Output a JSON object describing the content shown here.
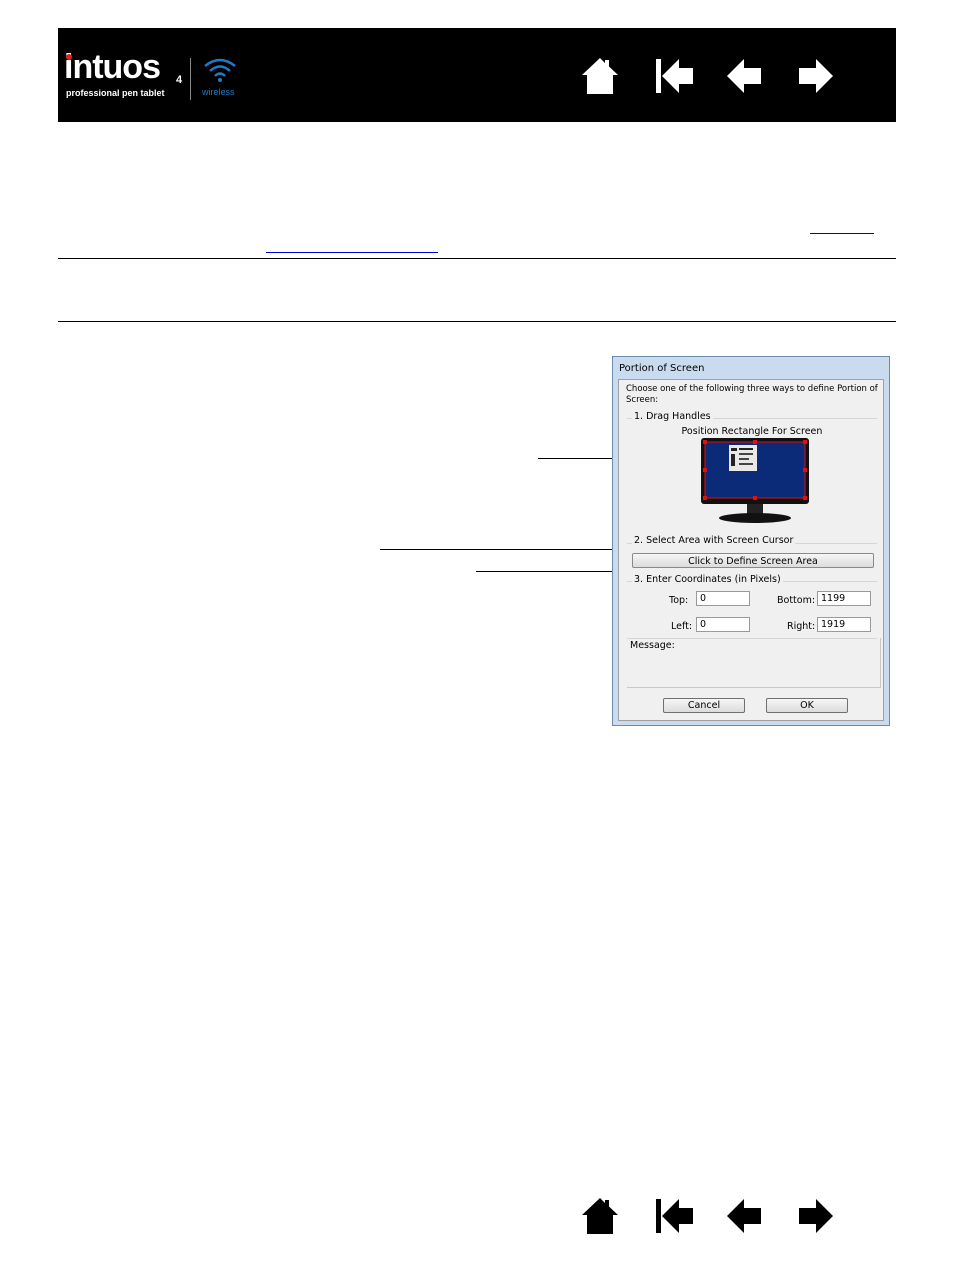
{
  "header": {
    "logo": {
      "brand": "intuos",
      "model_number": "4",
      "tagline": "professional pen tablet",
      "variant": "wireless"
    },
    "nav": [
      {
        "name": "home-icon",
        "label": "Home"
      },
      {
        "name": "first-page-icon",
        "label": "Contents"
      },
      {
        "name": "previous-page-icon",
        "label": "Previous page"
      },
      {
        "name": "next-page-icon",
        "label": "Next page"
      }
    ]
  },
  "dialog": {
    "title": "Portion of Screen",
    "instructions": "Choose one of the following three ways to define Portion of Screen:",
    "group1_title": "1. Drag Handles",
    "position_label": "Position Rectangle For Screen",
    "group2_title": "2. Select Area with Screen Cursor",
    "define_button": "Click to Define Screen Area",
    "group3_title": "3. Enter Coordinates (in Pixels)",
    "coords": {
      "top_label": "Top:",
      "top_value": "0",
      "bottom_label": "Bottom:",
      "bottom_value": "1199",
      "left_label": "Left:",
      "left_value": "0",
      "right_label": "Right:",
      "right_value": "1919"
    },
    "message_label": "Message:",
    "cancel_button": "Cancel",
    "ok_button": "OK"
  },
  "colors": {
    "header_bg": "#000000",
    "logo_accent": "#e2231a",
    "wireless_blue": "#1f7bc6",
    "screen_blue": "#0b2a78",
    "handle_red": "#e01010"
  }
}
